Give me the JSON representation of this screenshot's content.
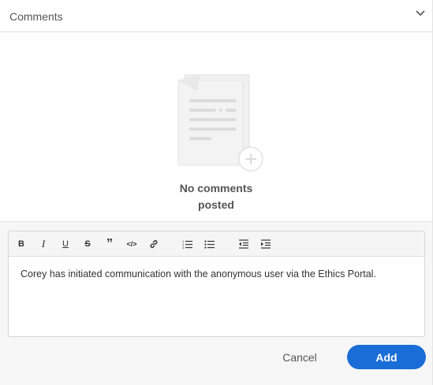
{
  "header": {
    "title": "Comments",
    "collapse_icon": "chevron-down-icon"
  },
  "empty_state": {
    "line1": "No comments",
    "line2": "posted",
    "illustration_icon": "document-add-icon"
  },
  "toolbar": {
    "items": [
      {
        "name": "bold",
        "glyph": "B"
      },
      {
        "name": "italic",
        "glyph": "I"
      },
      {
        "name": "underline",
        "glyph": "U"
      },
      {
        "name": "strikethrough",
        "glyph": "S"
      },
      {
        "name": "blockquote",
        "glyph": "”"
      },
      {
        "name": "code",
        "glyph": "</>"
      },
      {
        "name": "link",
        "glyph": "link"
      },
      {
        "name": "ordered-list",
        "glyph": "ol"
      },
      {
        "name": "bullet-list",
        "glyph": "ul"
      },
      {
        "name": "outdent",
        "glyph": "outdent"
      },
      {
        "name": "indent",
        "glyph": "indent"
      }
    ]
  },
  "editor": {
    "text": "Corey has initiated communication with the anonymous user via the Ethics Portal."
  },
  "actions": {
    "cancel_label": "Cancel",
    "add_label": "Add"
  },
  "colors": {
    "accent": "#1a6dd6",
    "composer_bg": "#f6f6f6"
  }
}
